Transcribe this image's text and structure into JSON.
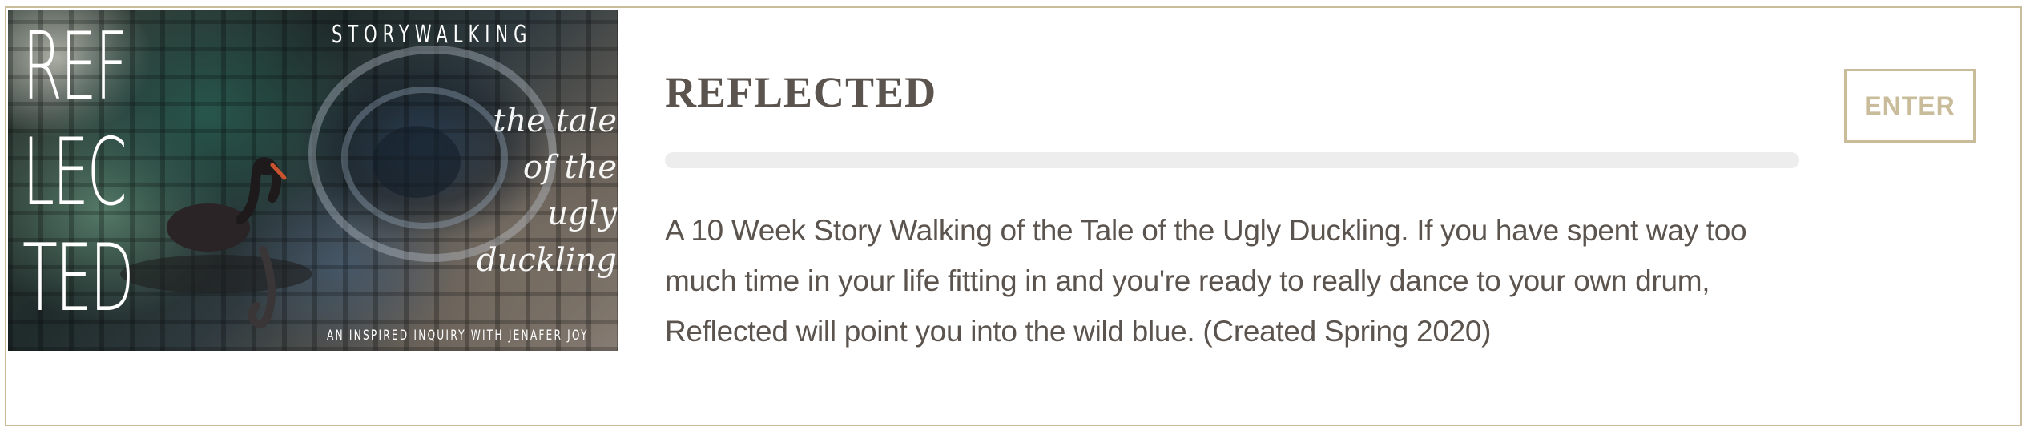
{
  "card": {
    "title": "REFLECTED",
    "description": "A 10 Week Story Walking of the Tale of the Ugly Duckling. If you have spent way too much time in your life fitting in and you're ready to really dance to your own drum, Reflected will point you into the wild blue. (Created Spring 2020)",
    "enter_label": "ENTER",
    "progress_fraction": 0
  },
  "thumbnail": {
    "big_text": "REF\nLEC\nTED",
    "header": "STORYWALKING",
    "script": "the tale of the ugly duckling",
    "tagline": "AN INSPIRED INQUIRY WITH JENAFER JOY"
  },
  "colors": {
    "accent": "#c9bc9b",
    "text": "#5b534d",
    "track": "#ededed"
  }
}
